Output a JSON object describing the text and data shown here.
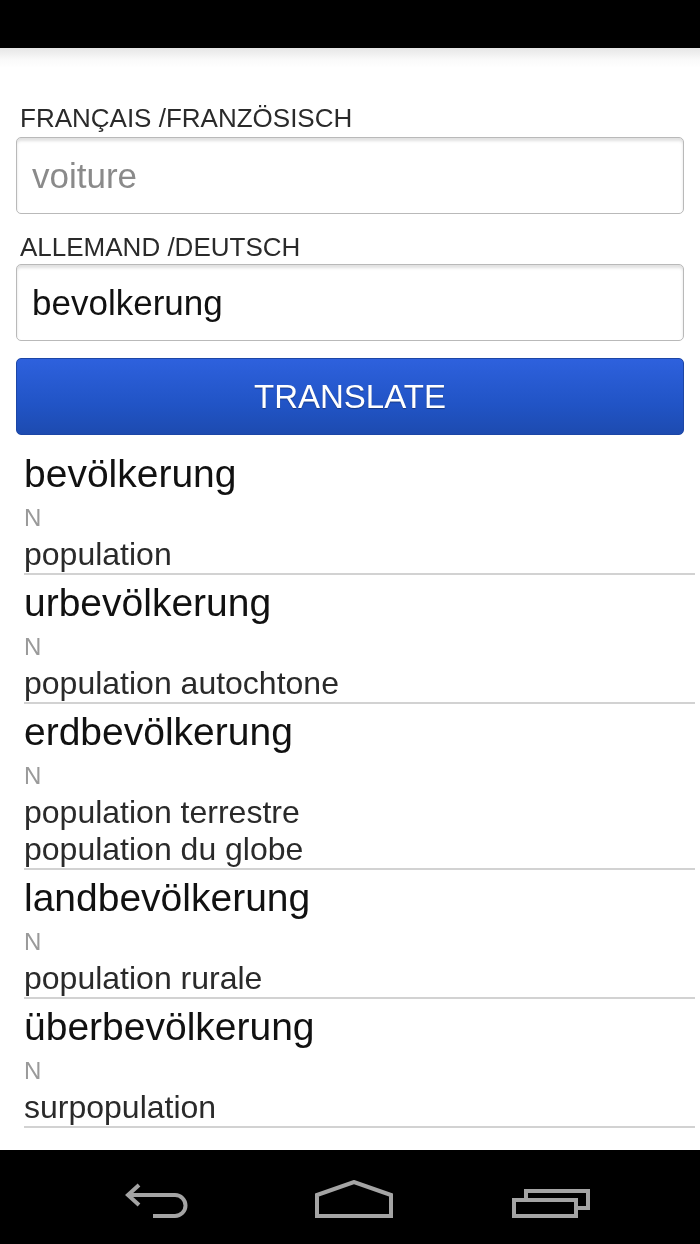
{
  "fields": [
    {
      "label": "FRANÇAIS /FRANZÖSISCH",
      "placeholder": "voiture"
    },
    {
      "label": "ALLEMAND /DEUTSCH",
      "value": "bevolkerung"
    }
  ],
  "translate_button": {
    "label": "TRANSLATE"
  },
  "results": [
    {
      "headword": "bevölkerung",
      "part_of_speech": "N",
      "translations": [
        "population"
      ]
    },
    {
      "headword": "urbevölkerung",
      "part_of_speech": "N",
      "translations": [
        "population autochtone"
      ]
    },
    {
      "headword": "erdbevölkerung",
      "part_of_speech": "N",
      "translations": [
        "population terrestre",
        "population du globe"
      ]
    },
    {
      "headword": "landbevölkerung",
      "part_of_speech": "N",
      "translations": [
        "population rurale"
      ]
    },
    {
      "headword": "überbevölkerung",
      "part_of_speech": "N",
      "translations": [
        "surpopulation"
      ]
    }
  ]
}
